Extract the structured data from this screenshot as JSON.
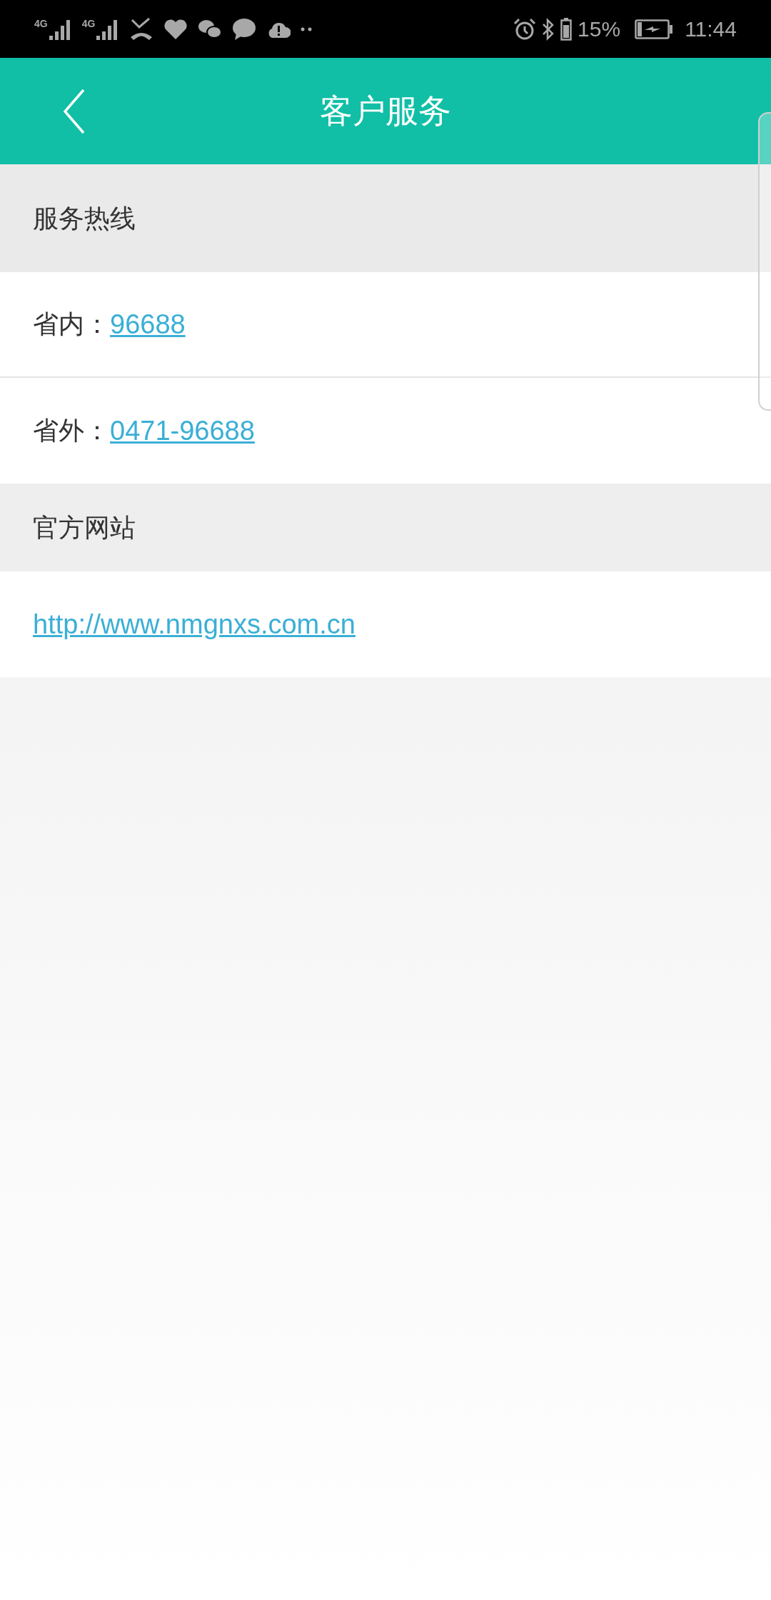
{
  "status_bar": {
    "networks": [
      "4G",
      "4G"
    ],
    "battery_percent": "15%",
    "time": "11:44"
  },
  "header": {
    "title": "客户服务"
  },
  "sections": [
    {
      "title": "服务热线",
      "rows": [
        {
          "label": "省内：",
          "link": "96688"
        },
        {
          "label": "省外：",
          "link": "0471-96688"
        }
      ]
    },
    {
      "title": "官方网站",
      "rows": [
        {
          "link": "http://www.nmgnxs.com.cn"
        }
      ]
    }
  ]
}
